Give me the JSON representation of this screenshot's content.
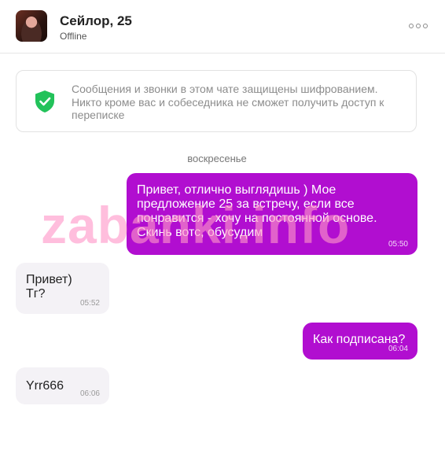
{
  "header": {
    "contact_name": "Сейлор, 25",
    "status": "Offline",
    "avatar_icon": "avatar-photo",
    "menu_icon": "more-options-icon"
  },
  "encryption_notice": {
    "icon": "shield-check-icon",
    "icon_color": "#22c25a",
    "text": "Сообщения и звонки в этом чате защищены шифрованием. Никто кроме вас и собеседника не сможет получить доступ к переписке"
  },
  "day_separator": "воскресенье",
  "messages": [
    {
      "direction": "outgoing",
      "text": "Привет, отлично выглядишь ) Мое предложение 25 за встречу, если все понравится - хочу на постоянной основе. Скинь вотс, обусудим",
      "time": "05:50"
    },
    {
      "direction": "incoming",
      "text": "Привет)\nТг?",
      "time": "05:52"
    },
    {
      "direction": "outgoing",
      "text": "Как подписана?",
      "time": "06:04"
    },
    {
      "direction": "incoming",
      "text": "Yrr666",
      "time": "06:06"
    }
  ],
  "watermark": "zabanki.info",
  "colors": {
    "outgoing_bubble": "#b10ed0",
    "incoming_bubble": "#f4f2f6",
    "watermark": "#ff96c8"
  }
}
